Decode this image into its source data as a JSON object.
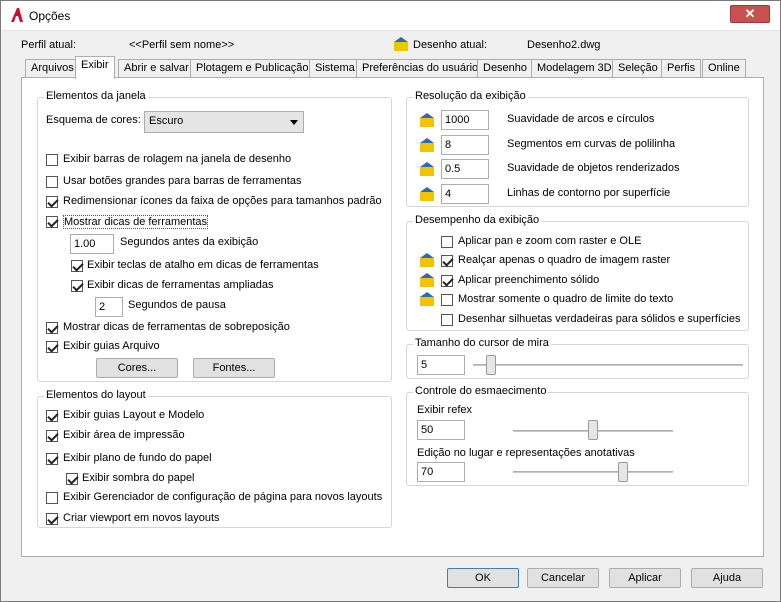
{
  "window": {
    "title": "Opções",
    "close_label": "✕"
  },
  "profile": {
    "label": "Perfil atual:",
    "value": "<<Perfil sem nome>>",
    "drawing_label": "Desenho atual:",
    "drawing_value": "Desenho2.dwg"
  },
  "tabs": [
    "Arquivos",
    "Exibir",
    "Abrir e salvar",
    "Plotagem e Publicação",
    "Sistema",
    "Preferências do usuário",
    "Desenho",
    "Modelagem 3D",
    "Seleção",
    "Perfis",
    "Online"
  ],
  "window_elements": {
    "title": "Elementos da janela",
    "color_scheme_label": "Esquema de cores:",
    "color_scheme_value": "Escuro",
    "checkboxes": [
      {
        "label": "Exibir barras de rolagem na janela de desenho",
        "checked": false
      },
      {
        "label": "Usar botões grandes para barras de ferramentas",
        "checked": false
      },
      {
        "label": "Redimensionar ícones da faixa de opções para tamanhos padrão",
        "checked": true
      },
      {
        "label": "Mostrar dicas de ferramentas",
        "checked": true
      }
    ],
    "delay_value": "1.00",
    "delay_label": "Segundos antes da exibição",
    "shortcut_label": "Exibir teclas de atalho em dicas de ferramentas",
    "extended_label": "Exibir dicas de ferramentas ampliadas",
    "pause_value": "2",
    "pause_label": "Segundos de pausa",
    "rollover_label": "Mostrar dicas de ferramentas de sobreposição",
    "file_tabs_label": "Exibir guias Arquivo",
    "colors_button": "Cores...",
    "fonts_button": "Fontes..."
  },
  "layout_elements": {
    "title": "Elementos do layout",
    "items": [
      {
        "label": "Exibir guias Layout e Modelo",
        "checked": true
      },
      {
        "label": "Exibir área de impressão",
        "checked": true
      },
      {
        "label": "Exibir plano de fundo do papel",
        "checked": true
      }
    ],
    "shadow_label": "Exibir sombra do papel",
    "items2": [
      {
        "label": "Exibir Gerenciador de configuração de página para novos layouts",
        "checked": false
      },
      {
        "label": "Criar viewport em novos layouts",
        "checked": true
      }
    ]
  },
  "resolution": {
    "title": "Resolução da exibição",
    "rows": [
      {
        "value": "1000",
        "label": "Suavidade de arcos e círculos"
      },
      {
        "value": "8",
        "label": "Segmentos em curvas de polilinha"
      },
      {
        "value": "0.5",
        "label": "Suavidade de objetos renderizados"
      },
      {
        "value": "4",
        "label": "Linhas de contorno por superfície"
      }
    ]
  },
  "performance": {
    "title": "Desempenho da exibição",
    "items": [
      {
        "label": "Aplicar pan e zoom com raster e OLE",
        "checked": false
      },
      {
        "label": "Realçar apenas o quadro de imagem raster",
        "checked": true
      },
      {
        "label": "Aplicar preenchimento sólido",
        "checked": true
      },
      {
        "label": "Mostrar somente o quadro de limite do texto",
        "checked": false
      },
      {
        "label": "Desenhar silhuetas verdadeiras para sólidos e superfícies",
        "checked": false
      }
    ]
  },
  "crosshair": {
    "title": "Tamanho do cursor de mira",
    "value": "5",
    "level_fraction": 0.05
  },
  "fade": {
    "title": "Controle do esmaecimento",
    "xref_label": "Exibir refex",
    "xref_value": "50",
    "xref_fraction": 0.5,
    "inplace_label": "Edição no lugar e representações anotativas",
    "inplace_value": "70",
    "inplace_fraction": 0.7
  },
  "buttons": {
    "ok": "OK",
    "cancel": "Cancelar",
    "apply": "Aplicar",
    "help": "Ajuda"
  }
}
